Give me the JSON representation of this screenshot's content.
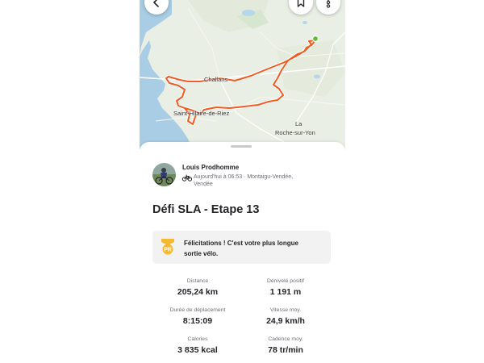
{
  "map": {
    "places": {
      "challans": "Challans",
      "saint_hilaire": "Saint-Hilaire-de-Riez",
      "la": "La",
      "roche_sur_yon": "Roche-sur-Yon"
    },
    "route_color": "#f15a22",
    "start_marker_color": "#5bbf3a",
    "buttons": {
      "back": "back-arrow-icon",
      "bookmark": "bookmark-icon",
      "more": "more-vertical-icon"
    }
  },
  "activity": {
    "athlete": "Louis Prodhomme",
    "meta_line1": "Aujourd'hui à 06:53 · Montaigu-Vendée,",
    "meta_line2": "Vendée",
    "sport_icon": "bike-icon",
    "title": "Défi SLA - Etape 13",
    "pr_badge": "PR",
    "pr_message_line1": "Félicitations ! C'est votre plus longue",
    "pr_message_line2": "sortie vélo."
  },
  "stats": [
    {
      "label": "Distance",
      "value": "205,24 km"
    },
    {
      "label": "Dénivelé positif",
      "value": "1 191 m"
    },
    {
      "label": "Durée de déplacement",
      "value": "8:15:09"
    },
    {
      "label": "Vitesse moy.",
      "value": "24,9 km/h"
    },
    {
      "label": "Calories",
      "value": "3 835 kcal"
    },
    {
      "label": "Cadence moy.",
      "value": "78 tr/min"
    }
  ],
  "colors": {
    "accent": "#fc4c02",
    "pr_gold": "#f5b82e",
    "card_bg": "#f2f2f2"
  }
}
